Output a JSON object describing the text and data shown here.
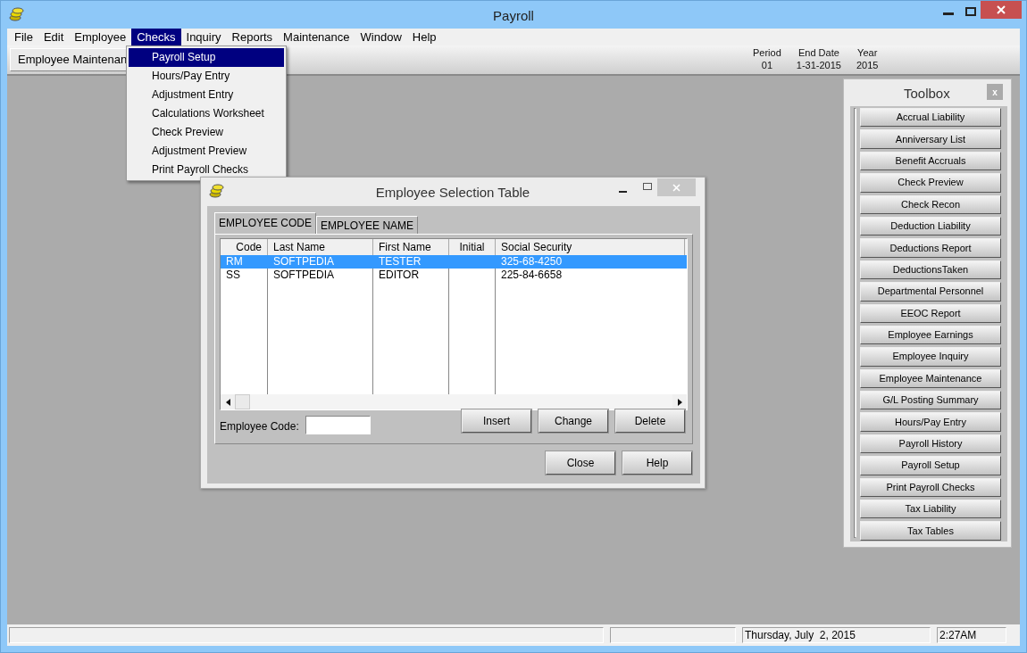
{
  "window": {
    "title": "Payroll"
  },
  "menu_bar": [
    {
      "label": "File",
      "selected": false
    },
    {
      "label": "Edit",
      "selected": false
    },
    {
      "label": "Employee",
      "selected": false
    },
    {
      "label": "Checks",
      "selected": true
    },
    {
      "label": "Inquiry",
      "selected": false
    },
    {
      "label": "Reports",
      "selected": false
    },
    {
      "label": "Maintenance",
      "selected": false
    },
    {
      "label": "Window",
      "selected": false
    },
    {
      "label": "Help",
      "selected": false
    }
  ],
  "open_menu": {
    "items": [
      {
        "label": "Payroll Setup",
        "selected": true
      },
      {
        "label": "Hours/Pay Entry",
        "selected": false
      },
      {
        "label": "Adjustment Entry",
        "selected": false
      },
      {
        "label": "Calculations Worksheet",
        "selected": false
      },
      {
        "label": "Check Preview",
        "selected": false
      },
      {
        "label": "Adjustment Preview",
        "selected": false
      },
      {
        "label": "Print Payroll Checks",
        "selected": false
      }
    ]
  },
  "toolbar": {
    "button": "Employee Maintenan",
    "period_info": [
      {
        "label": "Period",
        "value": "01"
      },
      {
        "label": "End Date",
        "value": "1-31-2015"
      },
      {
        "label": "Year",
        "value": "2015"
      }
    ]
  },
  "dialog": {
    "title": "Employee Selection Table",
    "tabs": [
      {
        "label": "EMPLOYEE CODE",
        "selected": true
      },
      {
        "label": "EMPLOYEE NAME",
        "selected": false
      }
    ],
    "table": {
      "columns": [
        "Code",
        "Last Name",
        "First Name",
        "Initial",
        "Social Security"
      ],
      "rows": [
        {
          "cells": [
            "RM",
            "SOFTPEDIA",
            "TESTER",
            "",
            "325-68-4250"
          ],
          "selected": true
        },
        {
          "cells": [
            "SS",
            "SOFTPEDIA",
            "EDITOR",
            "",
            "225-84-6658"
          ],
          "selected": false
        }
      ]
    },
    "field": {
      "label": "Employee Code:"
    },
    "buttons": [
      "Insert",
      "Change",
      "Delete"
    ],
    "footer_buttons": [
      "Close",
      "Help"
    ]
  },
  "toolbox": {
    "title": "Toolbox",
    "close": "x",
    "buttons": [
      "Accrual Liability",
      "Anniversary List",
      "Benefit Accruals",
      "Check Preview",
      "Check Recon",
      "Deduction Liability",
      "Deductions Report",
      "DeductionsTaken",
      "Departmental Personnel",
      "EEOC Report",
      "Employee Earnings",
      "Employee Inquiry",
      "Employee Maintenance",
      "G/L Posting Summary",
      "Hours/Pay Entry",
      "Payroll History",
      "Payroll Setup",
      "Print Payroll Checks",
      "Tax Liability",
      "Tax Tables"
    ]
  },
  "status_bar": {
    "date": "Thursday, July  2, 2015",
    "time": "2:27AM"
  }
}
